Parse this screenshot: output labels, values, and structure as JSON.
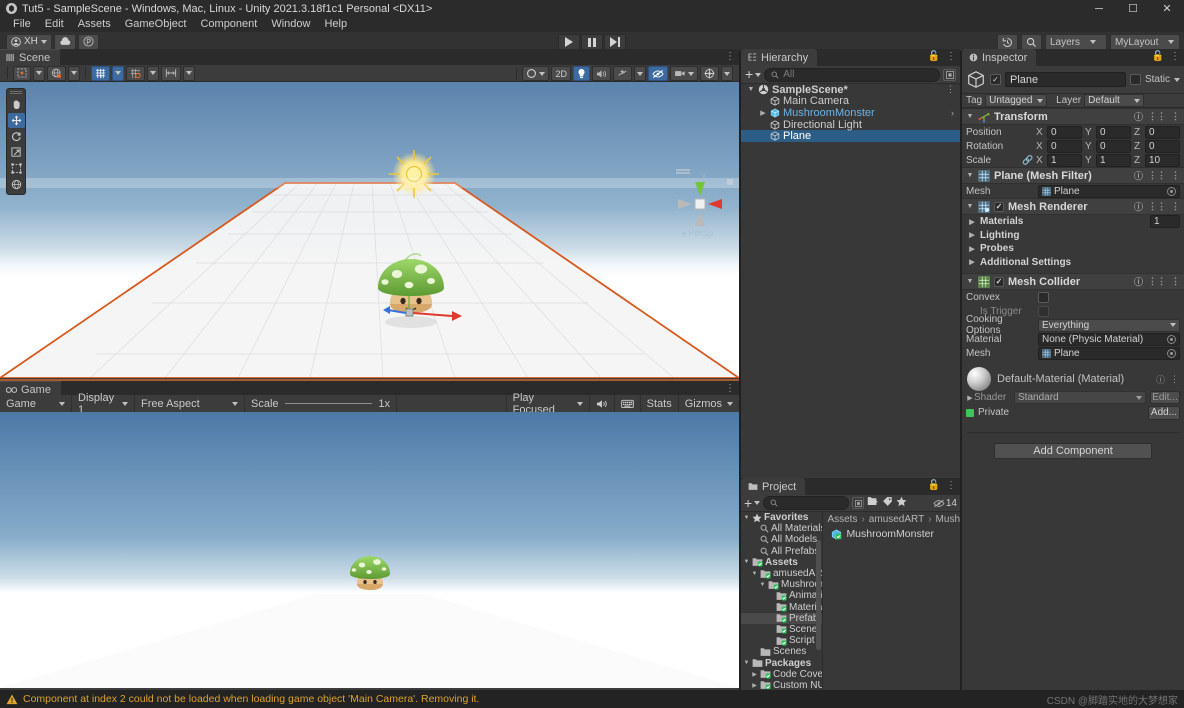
{
  "window": {
    "title": "Tut5 - SampleScene - Windows, Mac, Linux - Unity 2021.3.18f1c1 Personal <DX11>",
    "minimize": "─",
    "maximize": "☐",
    "close": "✕"
  },
  "menubar": {
    "items": [
      "File",
      "Edit",
      "Assets",
      "GameObject",
      "Component",
      "Window",
      "Help"
    ]
  },
  "toolbar": {
    "account": "XH",
    "cloud_icon": "cloud-icon",
    "collab_icon": "collab-icon",
    "play": "play-icon",
    "pause": "pause-icon",
    "step": "step-icon",
    "undo_history": "undo-history-icon",
    "search": "search-icon",
    "layers": "Layers",
    "layout": "MyLayout"
  },
  "scene": {
    "tab": "Scene",
    "tools": [
      "hand-tool",
      "move-tool",
      "rotate-tool",
      "scale-tool",
      "rect-tool",
      "transform-tool"
    ],
    "selected_tool": "move-tool",
    "pivot_mode": "Center",
    "handle_space": "Global",
    "grid_snap": "grid-snap-icon",
    "toggles": [
      "2D",
      "lighting",
      "audio",
      "fx",
      "hidden",
      "camera",
      "gizmos"
    ],
    "draw_mode": "Shaded",
    "persp_label": "Persp",
    "axis_x": "x",
    "axis_y": "y"
  },
  "game": {
    "tab": "Game",
    "view_mode": "Game",
    "display": "Display 1",
    "aspect": "Free Aspect",
    "scale_label": "Scale",
    "scale_value": "1x",
    "play_mode": "Play Focused",
    "mute_icon": "mute-audio-icon",
    "vsync_icon": "vsync-icon",
    "stats": "Stats",
    "gizmos": "Gizmos"
  },
  "hierarchy": {
    "tab": "Hierarchy",
    "add_label": "+",
    "search_placeholder": "All",
    "items": [
      {
        "label": "SampleScene*",
        "depth": 0,
        "arrow": "▼",
        "icon": "scene-icon",
        "selected": false,
        "bold": true
      },
      {
        "label": "Main Camera",
        "depth": 1,
        "arrow": "",
        "icon": "gameobject-icon",
        "selected": false,
        "bold": false
      },
      {
        "label": "MushroomMonster",
        "depth": 1,
        "arrow": "▶",
        "icon": "prefab-icon",
        "selected": false,
        "bold": false,
        "prefab": true
      },
      {
        "label": "Directional Light",
        "depth": 1,
        "arrow": "",
        "icon": "gameobject-icon",
        "selected": false,
        "bold": false
      },
      {
        "label": "Plane",
        "depth": 1,
        "arrow": "",
        "icon": "gameobject-icon",
        "selected": true,
        "bold": false
      }
    ]
  },
  "project": {
    "tab": "Project",
    "add_label": "+",
    "search_placeholder": "",
    "count_badge": "14",
    "breadcrumb": [
      "Assets",
      "amusedART",
      "Mush"
    ],
    "content_items": [
      {
        "label": "MushroomMonster",
        "icon": "prefab-icon"
      }
    ],
    "tree": [
      {
        "label": "Favorites",
        "depth": 0,
        "arrow": "▼",
        "icon": "star-icon",
        "bold": true,
        "selected": false
      },
      {
        "label": "All Materials",
        "depth": 1,
        "arrow": "",
        "icon": "search-icon",
        "bold": false,
        "selected": false
      },
      {
        "label": "All Models",
        "depth": 1,
        "arrow": "",
        "icon": "search-icon",
        "bold": false,
        "selected": false
      },
      {
        "label": "All Prefabs",
        "depth": 1,
        "arrow": "",
        "icon": "search-icon",
        "bold": false,
        "selected": false
      },
      {
        "label": "Assets",
        "depth": 0,
        "arrow": "▼",
        "icon": "folder-icon",
        "bold": true,
        "selected": false
      },
      {
        "label": "amusedART",
        "depth": 1,
        "arrow": "▼",
        "icon": "folder-icon",
        "bold": false,
        "selected": false
      },
      {
        "label": "Mushroom_",
        "depth": 2,
        "arrow": "▼",
        "icon": "folder-icon",
        "bold": false,
        "selected": false
      },
      {
        "label": "Animatic",
        "depth": 3,
        "arrow": "",
        "icon": "folder-icon",
        "bold": false,
        "selected": false
      },
      {
        "label": "Material",
        "depth": 3,
        "arrow": "",
        "icon": "folder-icon",
        "bold": false,
        "selected": false
      },
      {
        "label": "Prefab",
        "depth": 3,
        "arrow": "",
        "icon": "folder-icon",
        "bold": false,
        "selected": true
      },
      {
        "label": "Scene",
        "depth": 3,
        "arrow": "",
        "icon": "folder-icon",
        "bold": false,
        "selected": false
      },
      {
        "label": "Script",
        "depth": 3,
        "arrow": "",
        "icon": "folder-icon",
        "bold": false,
        "selected": false
      },
      {
        "label": "Scenes",
        "depth": 1,
        "arrow": "",
        "icon": "folder-icon",
        "bold": false,
        "selected": false
      },
      {
        "label": "Packages",
        "depth": 0,
        "arrow": "▼",
        "icon": "folder-icon",
        "bold": true,
        "selected": false
      },
      {
        "label": "Code Covera",
        "depth": 1,
        "arrow": "▶",
        "icon": "folder-icon",
        "bold": false,
        "selected": false
      },
      {
        "label": "Custom NUni",
        "depth": 1,
        "arrow": "▶",
        "icon": "folder-icon",
        "bold": false,
        "selected": false
      }
    ]
  },
  "inspector": {
    "tab": "Inspector",
    "object_name": "Plane",
    "enabled": true,
    "static_label": "Static",
    "tag_label": "Tag",
    "tag_value": "Untagged",
    "layer_label": "Layer",
    "layer_value": "Default",
    "transform": {
      "title": "Transform",
      "rows": [
        {
          "label": "Position",
          "x": "0",
          "y": "0",
          "z": "0",
          "link": false
        },
        {
          "label": "Rotation",
          "x": "0",
          "y": "0",
          "z": "0",
          "link": false
        },
        {
          "label": "Scale",
          "x": "1",
          "y": "1",
          "z": "10",
          "link": true
        }
      ],
      "axes": [
        "X",
        "Y",
        "Z"
      ]
    },
    "mesh_filter": {
      "title": "Plane (Mesh Filter)",
      "mesh_label": "Mesh",
      "mesh_value": "Plane"
    },
    "mesh_renderer": {
      "title": "Mesh Renderer",
      "enabled": true,
      "foldouts": [
        {
          "label": "Materials",
          "value": "1"
        },
        {
          "label": "Lighting",
          "value": ""
        },
        {
          "label": "Probes",
          "value": ""
        },
        {
          "label": "Additional Settings",
          "value": ""
        }
      ]
    },
    "mesh_collider": {
      "title": "Mesh Collider",
      "enabled": true,
      "convex_label": "Convex",
      "convex_value": false,
      "is_trigger_label": "Is Trigger",
      "is_trigger_value": false,
      "cooking_label": "Cooking Options",
      "cooking_value": "Everything",
      "material_label": "Material",
      "material_value": "None (Physic Material)",
      "mesh_label": "Mesh",
      "mesh_value": "Plane"
    },
    "material": {
      "title": "Default-Material (Material)",
      "shader_label": "Shader",
      "shader_value": "Standard",
      "edit_label": "Edit...",
      "private_label": "Private",
      "add_label": "Add..."
    },
    "add_component": "Add Component"
  },
  "statusbar": {
    "icon": "warning-icon",
    "message": "Component at index 2 could not be loaded when loading game object 'Main Camera'. Removing it.",
    "watermark": "CSDN @脚踏实地的大梦想家"
  },
  "colors": {
    "accent_blue": "#2c5d87",
    "selection_orange": "#d75a1e",
    "warning": "#dca32b",
    "panel_bg": "#383838",
    "toolbar_bg": "#3c3c3c"
  }
}
